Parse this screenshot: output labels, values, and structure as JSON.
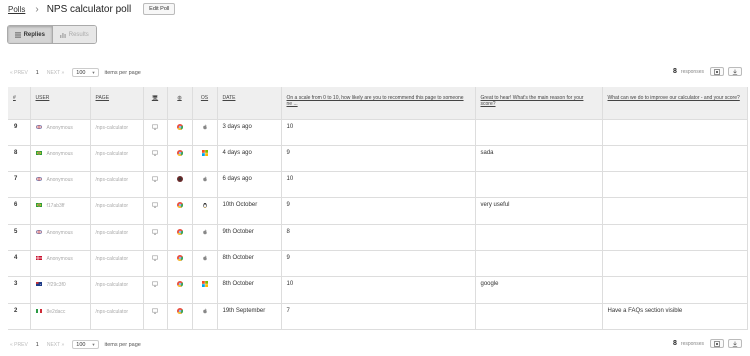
{
  "breadcrumb": {
    "root": "Polls",
    "title": "NPS calculator poll",
    "edit": "Edit Poll"
  },
  "tabs": [
    {
      "label": "Replies"
    },
    {
      "label": "Results"
    }
  ],
  "pager": {
    "prev": "« PREV",
    "page": "1",
    "next": "NEXT »",
    "per_page": "100",
    "items_label": "items per page"
  },
  "responses": {
    "count": "8",
    "label": "responses"
  },
  "columns": {
    "num": "#",
    "user": "USER",
    "page": "PAGE",
    "os": "OS",
    "date": "DATE",
    "q1": "On a scale from 0 to 10, how likely are you to recommend this page to someone ne ...",
    "q2": "Great to hear! What's the main reason for your score?",
    "q3": "What can we do to improve our calculator - and your score?"
  },
  "rows": [
    {
      "num": "9",
      "flag": "uk",
      "user": "Anonymous",
      "page": "/nps-calculator",
      "browser": "chrome",
      "os": "apple",
      "date": "3 days ago",
      "score": "10",
      "reason": "",
      "improve": ""
    },
    {
      "num": "8",
      "flag": "br",
      "user": "Anonymous",
      "page": "/nps-calculator",
      "browser": "chrome",
      "os": "windows",
      "date": "4 days ago",
      "score": "9",
      "reason": "sada",
      "improve": ""
    },
    {
      "num": "7",
      "flag": "uk",
      "user": "Anonymous",
      "page": "/nps-calculator",
      "browser": "dark",
      "os": "apple",
      "date": "6 days ago",
      "score": "10",
      "reason": "",
      "improve": ""
    },
    {
      "num": "6",
      "flag": "br",
      "user": "f17ab3ff",
      "page": "/nps-calculator",
      "browser": "chrome",
      "os": "linux",
      "date": "10th October",
      "score": "9",
      "reason": "very useful",
      "improve": ""
    },
    {
      "num": "5",
      "flag": "uk",
      "user": "Anonymous",
      "page": "/nps-calculator",
      "browser": "chrome",
      "os": "apple",
      "date": "9th October",
      "score": "8",
      "reason": "",
      "improve": ""
    },
    {
      "num": "4",
      "flag": "dk",
      "user": "Anonymous",
      "page": "/nps-calculator",
      "browser": "chrome",
      "os": "apple",
      "date": "8th October",
      "score": "9",
      "reason": "",
      "improve": ""
    },
    {
      "num": "3",
      "flag": "au",
      "user": "7f29c3f0",
      "page": "/nps-calculator",
      "browser": "chrome",
      "os": "windows",
      "date": "8th October",
      "score": "10",
      "reason": "google",
      "improve": ""
    },
    {
      "num": "2",
      "flag": "it",
      "user": "8e2dacc",
      "page": "/nps-calculator",
      "browser": "chrome",
      "os": "apple",
      "date": "19th September",
      "score": "7",
      "reason": "",
      "improve": "Have a FAQs section visible"
    }
  ]
}
